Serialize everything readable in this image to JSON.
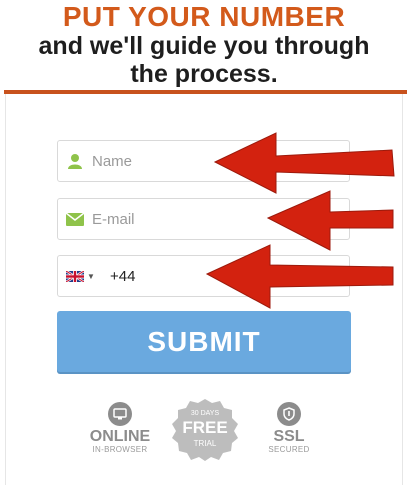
{
  "headline": {
    "accent": "PUT YOUR NUMBER",
    "line1": "and we'll guide you through",
    "line2": "the process."
  },
  "form": {
    "name_placeholder": "Name",
    "email_placeholder": "E-mail",
    "phone_value": "+44",
    "submit_label": "SUBMIT"
  },
  "badges": {
    "online_title": "ONLINE",
    "online_sub": "IN-BROWSER",
    "free_top": "30 DAYS",
    "free_title": "FREE",
    "free_sub": "TRIAL",
    "ssl_title": "SSL",
    "ssl_sub": "SECURED"
  },
  "colors": {
    "accent": "#d35a1b",
    "submit": "#6aa9df",
    "arrow": "#d3220f",
    "field_icon": "#8fc34a"
  },
  "icons": {
    "name": "user-icon",
    "email": "envelope-icon",
    "flag": "uk-flag-icon"
  }
}
